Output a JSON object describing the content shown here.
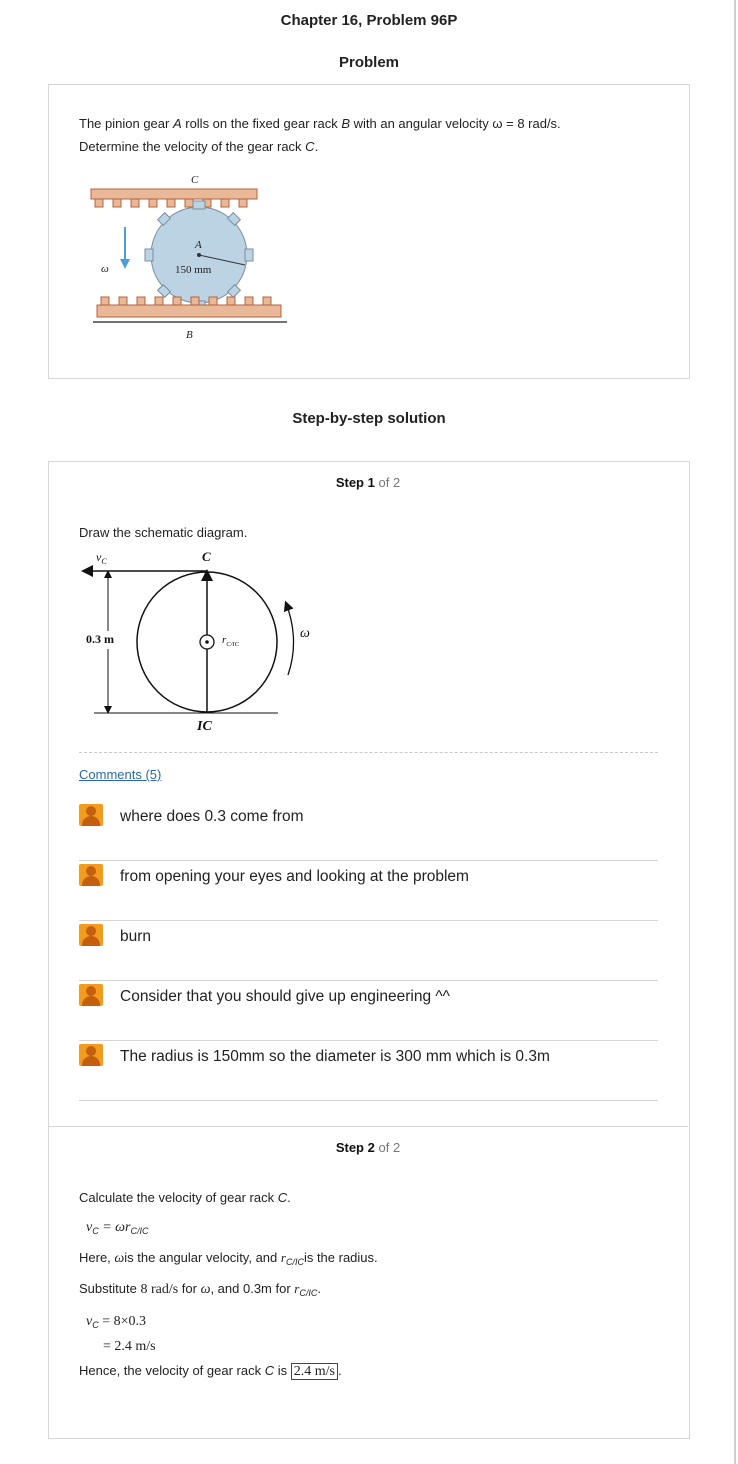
{
  "header": {
    "chapter_title": "Chapter 16, Problem 96P",
    "problem_heading": "Problem",
    "solution_heading": "Step-by-step solution"
  },
  "problem": {
    "text_line1_pre": "The pinion gear ",
    "text_line1_a": "A",
    "text_line1_mid": " rolls on the fixed gear rack ",
    "text_line1_b": "B",
    "text_line1_post": " with an angular velocity ω = 8 rad/s.",
    "text_line2_pre": "Determine the velocity of the gear rack ",
    "text_line2_c": "C",
    "text_line2_post": ".",
    "figure": {
      "label_top": "C",
      "label_center": "A",
      "label_radius": "150 mm",
      "label_omega": "ω",
      "label_bottom": "B",
      "colors": {
        "rack": "#e8b898",
        "rack_stroke": "#b4623c",
        "gear": "#bcd3e4",
        "arrow": "#4aa0d5"
      }
    }
  },
  "step1": {
    "label_step": "Step",
    "label_num": "1",
    "label_of": "of 2",
    "instruction": "Draw the schematic diagram.",
    "diagram": {
      "label_vc": "v",
      "label_vc_sub": "C",
      "label_top": "C",
      "label_height": "0.3 m",
      "label_r": "r",
      "label_r_sub": "C/IC",
      "label_omega": "ω",
      "label_ic": "IC"
    },
    "comments_link": "Comments (5)",
    "comments": [
      "where does 0.3 come from",
      "from opening your eyes and looking at the problem",
      "burn",
      "Consider that you should give up engineering ^^",
      "The radius is 150mm so the diameter is 300 mm which is 0.3m"
    ]
  },
  "step2": {
    "label_step": "Step",
    "label_num": "2",
    "label_of": "of 2",
    "line1_pre": "Calculate the velocity of gear rack ",
    "line1_c": "C",
    "line1_post": ".",
    "eq1_lhs": "v",
    "eq1_lhs_sub": "C",
    "eq1_rhs": " = ωr",
    "eq1_rhs_sub": "C/IC",
    "here_pre": "Here, ",
    "here_omega": "ω",
    "here_mid": "is the angular velocity, and ",
    "here_r": "r",
    "here_r_sub": "C/IC",
    "here_post": "is the radius.",
    "subst_pre": "Substitute ",
    "subst_val1": "8 rad/s",
    "subst_for1": " for ",
    "subst_omega": "ω",
    "subst_mid": ", and 0.3m for ",
    "subst_r": "r",
    "subst_r_sub": "C/IC",
    "subst_post": ".",
    "calc1_lhs": "v",
    "calc1_lhs_sub": "C",
    "calc1_rhs": " = 8×0.3",
    "calc2": "= 2.4 m/s",
    "hence_pre": "Hence, the velocity of gear rack ",
    "hence_c": "C",
    "hence_mid": " is ",
    "answer": "2.4 m/s",
    "hence_post": "."
  }
}
